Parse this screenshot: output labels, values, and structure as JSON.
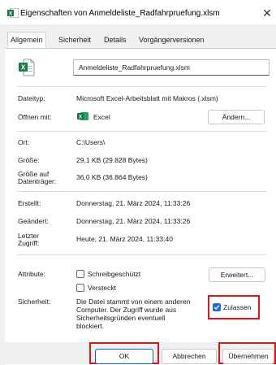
{
  "window": {
    "title": "Eigenschaften von Anmeldeliste_Radfahrpruefung.xlsm",
    "close_glyph": "✕"
  },
  "tabs": [
    "Allgemein",
    "Sicherheit",
    "Details",
    "Vorgängerversionen"
  ],
  "file_name": "Anmeldeliste_Radfahrpruefung.xlsm",
  "rows": {
    "type": {
      "label": "Dateityp:",
      "value": "Microsoft Excel-Arbeitsblatt mit Makros (.xlsm)"
    },
    "opens_with": {
      "label": "Öffnen mit:",
      "value": "Excel",
      "button": "Ändern..."
    },
    "location": {
      "label": "Ort:",
      "value": "C:\\Users\\"
    },
    "size": {
      "label": "Größe:",
      "value": "29,1 KB (29.828 Bytes)"
    },
    "size_on_disk": {
      "label1": "Größe auf",
      "label2": "Datenträger:",
      "value": "36,0 KB (36.864 Bytes)"
    },
    "created": {
      "label": "Erstellt:",
      "value": "Donnerstag, 21. März 2024, 11:33:26"
    },
    "modified": {
      "label": "Geändert:",
      "value": "Donnerstag, 21. März 2024, 11:33:26"
    },
    "accessed": {
      "label1": "Letzter",
      "label2": "Zugriff:",
      "value": "Heute, 21. März 2024, 11:33:40"
    }
  },
  "attributes": {
    "label": "Attribute:",
    "readonly": {
      "label": "Schreibgeschützt",
      "checked": false
    },
    "hidden": {
      "label": "Versteckt",
      "checked": false
    },
    "advanced_button": "Erweitert..."
  },
  "security": {
    "label": "Sicherheit:",
    "lines": [
      "Die Datei stammt von einem anderen",
      "Computer. Der Zugriff wurde aus",
      "Sicherheitsgründen eventuell",
      "blockiert."
    ],
    "unblock": {
      "label": "Zulassen",
      "checked": true
    }
  },
  "buttons": {
    "ok": "OK",
    "cancel": "Abbrechen",
    "apply": "Übernehmen"
  },
  "colors": {
    "excel_green": "#1d7a45",
    "highlight_red": "#e01515",
    "check_blue": "#1f6fd0"
  },
  "icons": {
    "title": "excel-file-icon",
    "file": "excel-file-icon",
    "app": "excel-app-icon"
  }
}
